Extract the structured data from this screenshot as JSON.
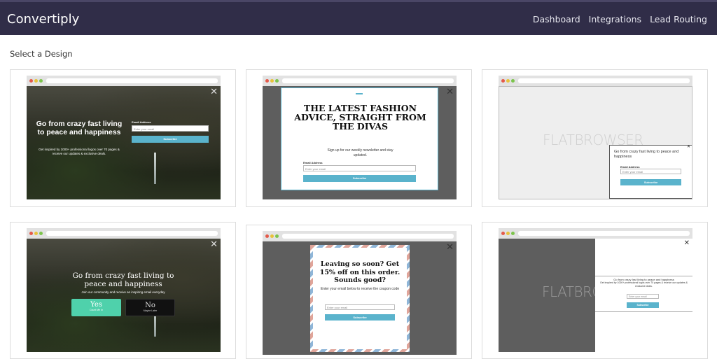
{
  "app": {
    "brand": "Convertiply",
    "nav": [
      "Dashboard",
      "Integrations",
      "Lead Routing"
    ]
  },
  "section_title": "Select a Design",
  "designs": [
    {
      "heading": "Go from crazy fast living to peace and happiness",
      "body": "Get inspired by 1000+ professional logos over 70 pages & receive our updates & exclusive deals.",
      "field_label": "Email Address",
      "placeholder": "Enter your email",
      "button": "Subscribe"
    },
    {
      "heading": "THE LATEST FASHION ADVICE, STRAIGHT FROM THE DIVAS",
      "body": "Sign up for our weekly newsletter and stay updated.",
      "field_label": "Email Address",
      "placeholder": "Enter your email",
      "button": "Subscribe"
    },
    {
      "bg_text": "FLATBROWSER",
      "heading": "Go from crazy fast living to peace and happiness",
      "field_label": "Email Address",
      "placeholder": "Enter your email",
      "button": "Subscribe"
    },
    {
      "heading": "Go from crazy fast living to peace and happiness",
      "body": "Join our community and receive an inspiring email everyday",
      "yes_label": "Yes",
      "yes_sub": "Count Me In",
      "no_label": "No",
      "no_sub": "Maybe Later"
    },
    {
      "heading": "Leaving so soon? Get 15% off on this order. Sounds good?",
      "body": "Enter your email below to receive the coupon code",
      "placeholder": "Enter your email",
      "button": "Subscribe"
    },
    {
      "bg_text": "FLATBROWSER",
      "heading": "Go from crazy fast living to peace and happiness",
      "body": "Get inspired by 1000+ professional logos over 70 pages & receive our updates & exclusive deals.",
      "placeholder": "Enter your email",
      "button": "Subscribe"
    }
  ],
  "icons": {
    "close": "close-icon",
    "window_dots": "window-controls-icon"
  },
  "colors": {
    "navbar": "#302d48",
    "accent": "#5ab3cc",
    "yes": "#4fd1ab"
  }
}
